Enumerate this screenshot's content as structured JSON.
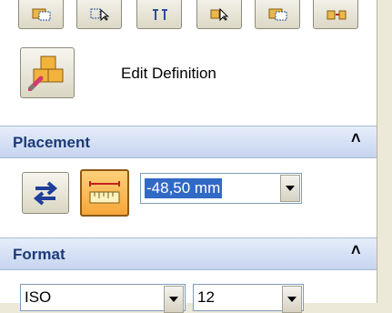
{
  "toolbar": {
    "buttons": [
      {
        "icon": "select-frame-icon"
      },
      {
        "icon": "select-multiple-icon"
      },
      {
        "icon": "align-icon"
      },
      {
        "icon": "select-pointer-icon"
      },
      {
        "icon": "select-frame-2-icon"
      },
      {
        "icon": "move-objects-icon"
      }
    ]
  },
  "edit": {
    "label": "Edit Definition",
    "icon": "edit-definition-icon"
  },
  "placement": {
    "title": "Placement",
    "collapse_glyph": "˄",
    "dimension_value": "-48,50 mm"
  },
  "format": {
    "title": "Format",
    "collapse_glyph": "˄",
    "standard_value": "ISO",
    "size_value": "12"
  },
  "colors": {
    "section_title": "#1d3b78",
    "active_button": "#f5a73a",
    "selection": "#316ac5"
  }
}
